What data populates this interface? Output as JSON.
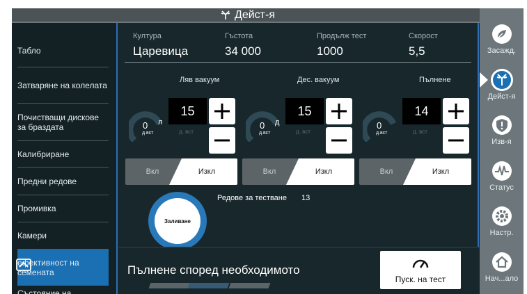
{
  "topbar": {
    "title": "Дейст-я"
  },
  "left_menu": [
    {
      "label": "Табло"
    },
    {
      "label": "Затваряне на колелата"
    },
    {
      "label": "Почистващи дискове за браздата"
    },
    {
      "label": "Калибриране"
    },
    {
      "label": "Предни редове"
    },
    {
      "label": "Промивка"
    },
    {
      "label": "Камери"
    },
    {
      "label": "ефективност на семената",
      "active": true
    },
    {
      "label": "Състояние на"
    }
  ],
  "header": {
    "crop_label": "Култура",
    "crop_value": "Царевица",
    "density_label": "Гъстота",
    "density_value": "34 000",
    "duration_label": "Продълж тест",
    "duration_value": "1000",
    "speed_label": "Скорост",
    "speed_value": "5,5"
  },
  "controls": [
    {
      "title": "Ляв вакуум",
      "value": "15",
      "gauge_value": "0",
      "gauge_side": "л",
      "gauge_unit": "д.вст",
      "unit": "д. вст",
      "on_label": "Вкл",
      "off_label": "Изкл"
    },
    {
      "title": "Дес. вакуум",
      "value": "15",
      "gauge_value": "0",
      "gauge_side": "д",
      "gauge_unit": "д.вст",
      "unit": "д. вст",
      "on_label": "Вкл",
      "off_label": "Изкл"
    },
    {
      "title": "Пълнене",
      "value": "14",
      "gauge_value": "0",
      "gauge_side": "",
      "gauge_unit": "д.вст",
      "unit": "д. вст",
      "on_label": "Вкл",
      "off_label": "Изкл"
    }
  ],
  "flood": {
    "label": "Заливане"
  },
  "test_rows": {
    "label": "Редове за тестване",
    "value": "13"
  },
  "bottom": {
    "fill_label": "Пълнене според необходимото",
    "test_button": "Пуск. на тест"
  },
  "right_bar": [
    {
      "label": "Засажд.",
      "icon": "planting-icon"
    },
    {
      "label": "Дейст-я",
      "icon": "actions-icon",
      "active": true
    },
    {
      "label": "Изв-я",
      "icon": "alerts-icon"
    },
    {
      "label": "Статус",
      "icon": "status-icon"
    },
    {
      "label": "Настр.",
      "icon": "settings-icon"
    },
    {
      "label": "Нач...ало",
      "icon": "home-icon"
    }
  ],
  "colors": {
    "accent": "#1b6fb3",
    "background": "#17272c",
    "gauge": "#2f4a55"
  }
}
